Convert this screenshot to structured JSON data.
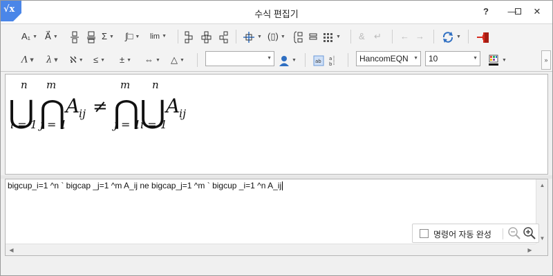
{
  "window": {
    "title": "수식 편집기",
    "app_icon_text": "√x"
  },
  "title_buttons": {
    "help": "?",
    "minimize": "—",
    "close": "✕"
  },
  "toolbar": {
    "row1": {
      "font_size_label": "A₁",
      "vector_label": "A⃗",
      "fraction_icon": "fraction-icon",
      "sqrt_icon": "sqrt-icon",
      "sum_label": "Σ",
      "integral_label": "∫□",
      "lim_label": "lim",
      "ampersand_label": "&",
      "enter_label": "↵",
      "left_arrow_label": "←",
      "right_arrow_label": "→"
    },
    "row2": {
      "greek_upper_label": "Λ",
      "greek_lower_label": "λ",
      "hebrew_label": "ℵ",
      "relation_label": "≤",
      "plusminus_label": "±",
      "arrow_label": "⇔",
      "triangle_label": "△",
      "style_combo_value": "",
      "font_name_value": "HancomEQN",
      "font_size_value": "10",
      "color_accent": "#d72b1e"
    }
  },
  "editor": {
    "script": "bigcup_i=1 ^n ` bigcap _j=1 ^m A_ij ne bigcap_j=1 ^m ` bigcup _i=1 ^n A_ij"
  },
  "formula": {
    "cup": "⋃",
    "cap": "⋂",
    "n": "n",
    "m": "m",
    "A": "A",
    "ij": "ij",
    "ne": "≠",
    "i1": "i = 1",
    "j1": "j = 1"
  },
  "autocomplete": {
    "label": "명령어 자동 완성",
    "checked": false
  },
  "colors": {
    "accent_blue": "#4a86e8",
    "window_bg": "#f0f0f0"
  }
}
